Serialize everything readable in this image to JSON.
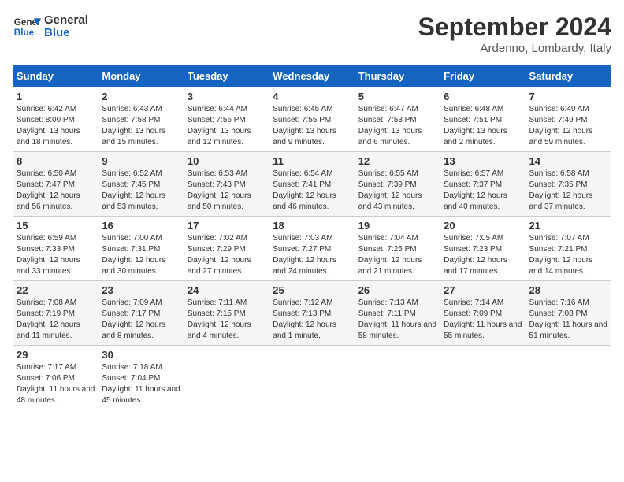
{
  "header": {
    "logo_line1": "General",
    "logo_line2": "Blue",
    "month": "September 2024",
    "location": "Ardenno, Lombardy, Italy"
  },
  "weekdays": [
    "Sunday",
    "Monday",
    "Tuesday",
    "Wednesday",
    "Thursday",
    "Friday",
    "Saturday"
  ],
  "weeks": [
    [
      {
        "day": "1",
        "sunrise": "Sunrise: 6:42 AM",
        "sunset": "Sunset: 8:00 PM",
        "daylight": "Daylight: 13 hours and 18 minutes."
      },
      {
        "day": "2",
        "sunrise": "Sunrise: 6:43 AM",
        "sunset": "Sunset: 7:58 PM",
        "daylight": "Daylight: 13 hours and 15 minutes."
      },
      {
        "day": "3",
        "sunrise": "Sunrise: 6:44 AM",
        "sunset": "Sunset: 7:56 PM",
        "daylight": "Daylight: 13 hours and 12 minutes."
      },
      {
        "day": "4",
        "sunrise": "Sunrise: 6:45 AM",
        "sunset": "Sunset: 7:55 PM",
        "daylight": "Daylight: 13 hours and 9 minutes."
      },
      {
        "day": "5",
        "sunrise": "Sunrise: 6:47 AM",
        "sunset": "Sunset: 7:53 PM",
        "daylight": "Daylight: 13 hours and 6 minutes."
      },
      {
        "day": "6",
        "sunrise": "Sunrise: 6:48 AM",
        "sunset": "Sunset: 7:51 PM",
        "daylight": "Daylight: 13 hours and 2 minutes."
      },
      {
        "day": "7",
        "sunrise": "Sunrise: 6:49 AM",
        "sunset": "Sunset: 7:49 PM",
        "daylight": "Daylight: 12 hours and 59 minutes."
      }
    ],
    [
      {
        "day": "8",
        "sunrise": "Sunrise: 6:50 AM",
        "sunset": "Sunset: 7:47 PM",
        "daylight": "Daylight: 12 hours and 56 minutes."
      },
      {
        "day": "9",
        "sunrise": "Sunrise: 6:52 AM",
        "sunset": "Sunset: 7:45 PM",
        "daylight": "Daylight: 12 hours and 53 minutes."
      },
      {
        "day": "10",
        "sunrise": "Sunrise: 6:53 AM",
        "sunset": "Sunset: 7:43 PM",
        "daylight": "Daylight: 12 hours and 50 minutes."
      },
      {
        "day": "11",
        "sunrise": "Sunrise: 6:54 AM",
        "sunset": "Sunset: 7:41 PM",
        "daylight": "Daylight: 12 hours and 46 minutes."
      },
      {
        "day": "12",
        "sunrise": "Sunrise: 6:55 AM",
        "sunset": "Sunset: 7:39 PM",
        "daylight": "Daylight: 12 hours and 43 minutes."
      },
      {
        "day": "13",
        "sunrise": "Sunrise: 6:57 AM",
        "sunset": "Sunset: 7:37 PM",
        "daylight": "Daylight: 12 hours and 40 minutes."
      },
      {
        "day": "14",
        "sunrise": "Sunrise: 6:58 AM",
        "sunset": "Sunset: 7:35 PM",
        "daylight": "Daylight: 12 hours and 37 minutes."
      }
    ],
    [
      {
        "day": "15",
        "sunrise": "Sunrise: 6:59 AM",
        "sunset": "Sunset: 7:33 PM",
        "daylight": "Daylight: 12 hours and 33 minutes."
      },
      {
        "day": "16",
        "sunrise": "Sunrise: 7:00 AM",
        "sunset": "Sunset: 7:31 PM",
        "daylight": "Daylight: 12 hours and 30 minutes."
      },
      {
        "day": "17",
        "sunrise": "Sunrise: 7:02 AM",
        "sunset": "Sunset: 7:29 PM",
        "daylight": "Daylight: 12 hours and 27 minutes."
      },
      {
        "day": "18",
        "sunrise": "Sunrise: 7:03 AM",
        "sunset": "Sunset: 7:27 PM",
        "daylight": "Daylight: 12 hours and 24 minutes."
      },
      {
        "day": "19",
        "sunrise": "Sunrise: 7:04 AM",
        "sunset": "Sunset: 7:25 PM",
        "daylight": "Daylight: 12 hours and 21 minutes."
      },
      {
        "day": "20",
        "sunrise": "Sunrise: 7:05 AM",
        "sunset": "Sunset: 7:23 PM",
        "daylight": "Daylight: 12 hours and 17 minutes."
      },
      {
        "day": "21",
        "sunrise": "Sunrise: 7:07 AM",
        "sunset": "Sunset: 7:21 PM",
        "daylight": "Daylight: 12 hours and 14 minutes."
      }
    ],
    [
      {
        "day": "22",
        "sunrise": "Sunrise: 7:08 AM",
        "sunset": "Sunset: 7:19 PM",
        "daylight": "Daylight: 12 hours and 11 minutes."
      },
      {
        "day": "23",
        "sunrise": "Sunrise: 7:09 AM",
        "sunset": "Sunset: 7:17 PM",
        "daylight": "Daylight: 12 hours and 8 minutes."
      },
      {
        "day": "24",
        "sunrise": "Sunrise: 7:11 AM",
        "sunset": "Sunset: 7:15 PM",
        "daylight": "Daylight: 12 hours and 4 minutes."
      },
      {
        "day": "25",
        "sunrise": "Sunrise: 7:12 AM",
        "sunset": "Sunset: 7:13 PM",
        "daylight": "Daylight: 12 hours and 1 minute."
      },
      {
        "day": "26",
        "sunrise": "Sunrise: 7:13 AM",
        "sunset": "Sunset: 7:11 PM",
        "daylight": "Daylight: 11 hours and 58 minutes."
      },
      {
        "day": "27",
        "sunrise": "Sunrise: 7:14 AM",
        "sunset": "Sunset: 7:09 PM",
        "daylight": "Daylight: 11 hours and 55 minutes."
      },
      {
        "day": "28",
        "sunrise": "Sunrise: 7:16 AM",
        "sunset": "Sunset: 7:08 PM",
        "daylight": "Daylight: 11 hours and 51 minutes."
      }
    ],
    [
      {
        "day": "29",
        "sunrise": "Sunrise: 7:17 AM",
        "sunset": "Sunset: 7:06 PM",
        "daylight": "Daylight: 11 hours and 48 minutes."
      },
      {
        "day": "30",
        "sunrise": "Sunrise: 7:18 AM",
        "sunset": "Sunset: 7:04 PM",
        "daylight": "Daylight: 11 hours and 45 minutes."
      },
      null,
      null,
      null,
      null,
      null
    ]
  ]
}
